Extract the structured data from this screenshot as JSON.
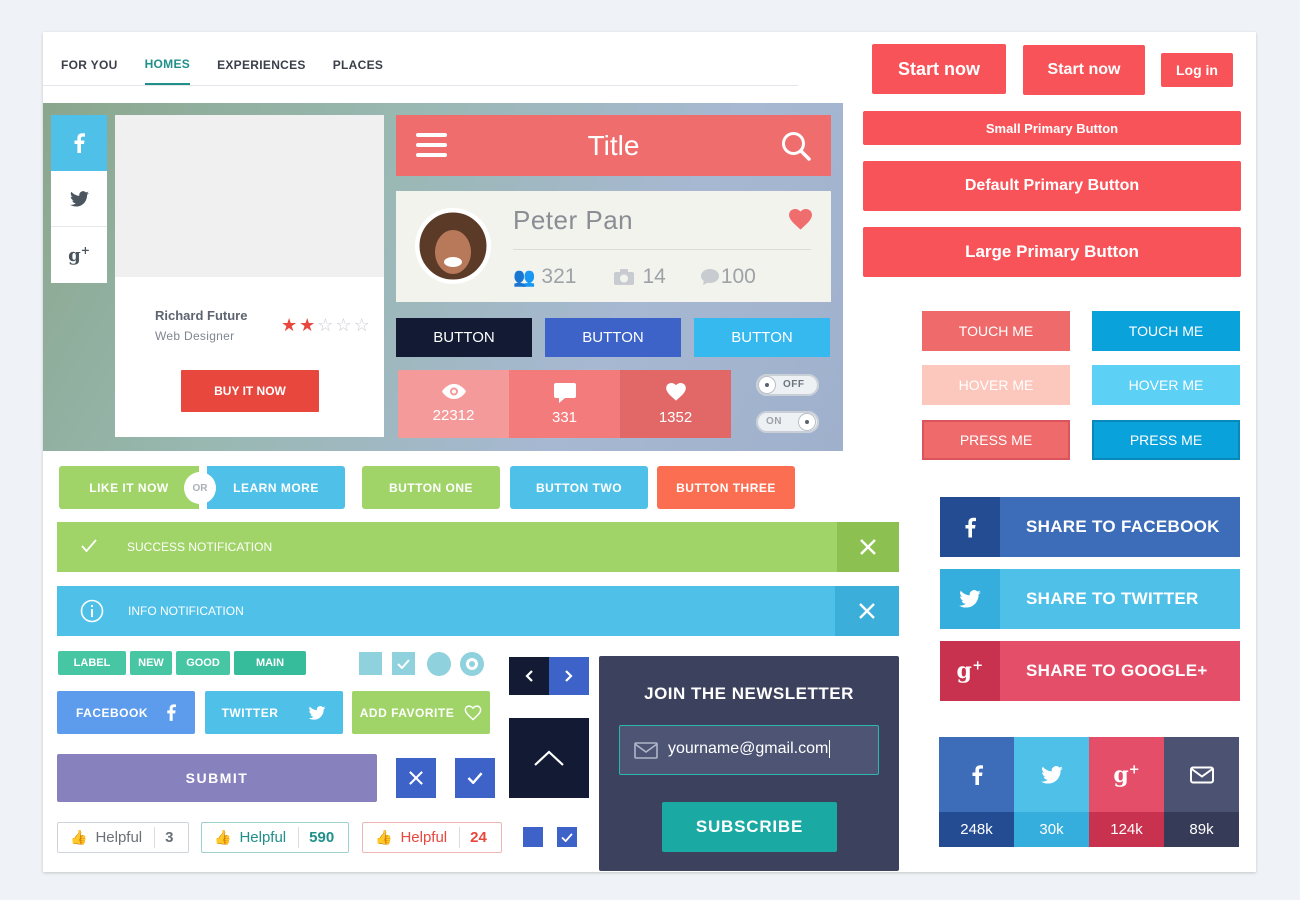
{
  "nav": {
    "tabs": [
      {
        "label": "FOR YOU"
      },
      {
        "label": "HOMES"
      },
      {
        "label": "EXPERIENCES"
      },
      {
        "label": "PLACES"
      }
    ]
  },
  "buttons_top": {
    "start_now_lg": "Start now",
    "start_now_md": "Start now",
    "login": "Log in"
  },
  "primary": {
    "small": "Small Primary Button",
    "default": "Default Primary Button",
    "large": "Large Primary Button"
  },
  "product_card": {
    "name": "Richard Future",
    "role": "Web Designer",
    "buy": "BUY IT NOW",
    "rating": 2,
    "rating_max": 5
  },
  "titlebar": {
    "title": "Title"
  },
  "profile": {
    "name": "Peter Pan",
    "followers": "321",
    "photos": "14",
    "comments": "100"
  },
  "dark_buttons": [
    "BUTTON",
    "BUTTON",
    "BUTTON"
  ],
  "stats": [
    {
      "value": "22312"
    },
    {
      "value": "331"
    },
    {
      "value": "1352"
    }
  ],
  "toggles": {
    "off": "OFF",
    "on": "ON"
  },
  "touch": {
    "touch": "TOUCH ME",
    "hover": "HOVER ME",
    "press": "PRESS ME"
  },
  "pill_buttons": {
    "like": "LIKE IT NOW",
    "or": "OR",
    "learn": "LEARN MORE",
    "one": "BUTTON ONE",
    "two": "BUTTON TWO",
    "three": "BUTTON THREE"
  },
  "notifications": {
    "success": "SUCCESS NOTIFICATION",
    "info": "INFO NOTIFICATION"
  },
  "tags": [
    "LABEL",
    "NEW",
    "GOOD",
    "MAIN"
  ],
  "social_btns": {
    "facebook": "FACEBOOK",
    "twitter": "TWITTER",
    "favorite": "ADD FAVORITE"
  },
  "submit": "SUBMIT",
  "helpful": [
    {
      "label": "Helpful",
      "count": "3"
    },
    {
      "label": "Helpful",
      "count": "590"
    },
    {
      "label": "Helpful",
      "count": "24"
    }
  ],
  "newsletter": {
    "title": "JOIN THE NEWSLETTER",
    "email": "yourname@gmail.com",
    "subscribe": "SUBSCRIBE"
  },
  "share": {
    "facebook": "SHARE TO FACEBOOK",
    "twitter": "SHARE TO TWITTER",
    "google": "SHARE TO GOOGLE+"
  },
  "share_counts": [
    {
      "icon": "facebook-icon",
      "count": "248k"
    },
    {
      "icon": "twitter-icon",
      "count": "30k"
    },
    {
      "icon": "google-plus-icon",
      "count": "124k"
    },
    {
      "icon": "mail-icon",
      "count": "89k"
    }
  ],
  "colors": {
    "primary": "#f85358",
    "teal": "#20908a",
    "green": "#a0d468",
    "blue": "#4fc1e9",
    "dark": "#3c415e"
  }
}
